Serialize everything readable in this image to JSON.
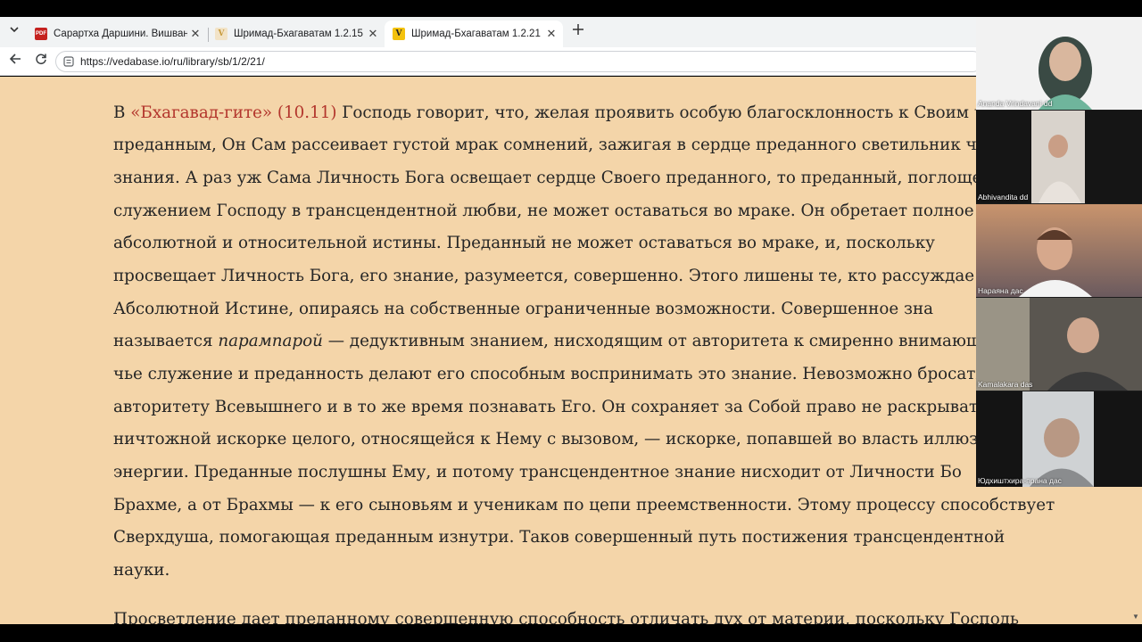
{
  "browser": {
    "tabs": [
      {
        "title": "Сарартха Даршини. Вишванатха",
        "favicon": "pdf-icon",
        "active": false
      },
      {
        "title": "Шримад-Бхагаватам 1.2.15",
        "favicon": "vedabase-icon",
        "active": false
      },
      {
        "title": "Шримад-Бхагаватам 1.2.21",
        "favicon": "vedabase-icon",
        "active": true
      }
    ],
    "url": "https://vedabase.io/ru/library/sb/1/2/21/",
    "colors": {
      "page_background": "#f4d5a9",
      "link": "#b3362d",
      "tab_strip": "#f1f3f4"
    }
  },
  "article": {
    "line1": {
      "prefix": "В ",
      "link": "«Бхагавад-гите» (10.11)",
      "suffix": " Господь говорит, что, желая проявить особую благосклонность к Своим чис"
    },
    "line2": "преданным, Он Сам рассеивает густой мрак сомнений, зажигая в сердце преданного светильник чис",
    "line3": "знания. А раз уж Сама Личность Бога освещает сердце Своего преданного, то преданный, поглощен",
    "line4": "служением Господу в трансцендентной любви, не может оставаться во мраке. Он обретает полное зна",
    "line5": "абсолютной и относительной истины. Преданный не может оставаться во мраке, и, поскольку",
    "line6": "просвещает Личность Бога, его знание, разумеется, совершенно. Этого лишены те, кто рассуждае",
    "line7": "Абсолютной Истине, опираясь на собственные ограниченные возможности. Совершенное зна",
    "line8": {
      "prefix": "называется ",
      "italic": "парампарой",
      "suffix": " — дедуктивным знанием, нисходящим от авторитета к смиренно внимающ"
    },
    "line9": "чье служение и преданность делают его способным воспринимать это знание. Невозможно бросать в",
    "line10": "авторитету Всевышнего и в то же время познавать Его. Он сохраняет за Собой право не раскрывать",
    "line11": "ничтожной искорке целого, относящейся к Нему с вызовом, — искорке, попавшей во власть иллюзо",
    "line12": "энергии. Преданные послушны Ему, и потому трансцендентное знание нисходит от Личности Бо",
    "line13": "Брахме, а от Брахмы — к его сыновьям и ученикам по цепи преемственности. Этому процессу способствует",
    "line14": "Сверхдуша, помогающая преданным изнутри. Таков совершенный путь постижения трансцендентной",
    "line15": "науки.",
    "line16": "Просветление дает преданному совершенную способность отличать дух от материи, поскольку Господь"
  },
  "participants": [
    {
      "name": "Ananda Vrindavani dd"
    },
    {
      "name": "Abhivandita dd"
    },
    {
      "name": "Нараяна дас"
    },
    {
      "name": "Kamalakara das"
    },
    {
      "name": "Юдхиштхира-прана дас"
    }
  ]
}
